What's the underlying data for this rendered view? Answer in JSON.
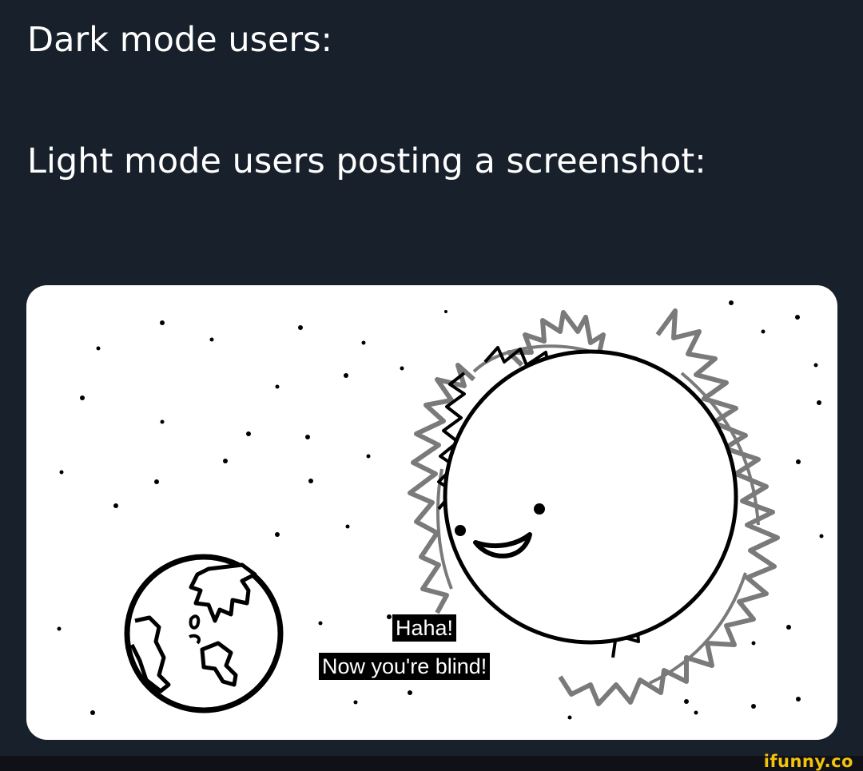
{
  "caption": {
    "line1": "Dark mode users:",
    "line2": "Light mode users posting a screenshot:"
  },
  "comic": {
    "subtitle_1": "Haha!",
    "subtitle_2": "Now you're blind!"
  },
  "watermark": "ifunny.co",
  "colors": {
    "background": "#18202b",
    "card": "#ffffff",
    "watermark": "#f4c30d"
  }
}
